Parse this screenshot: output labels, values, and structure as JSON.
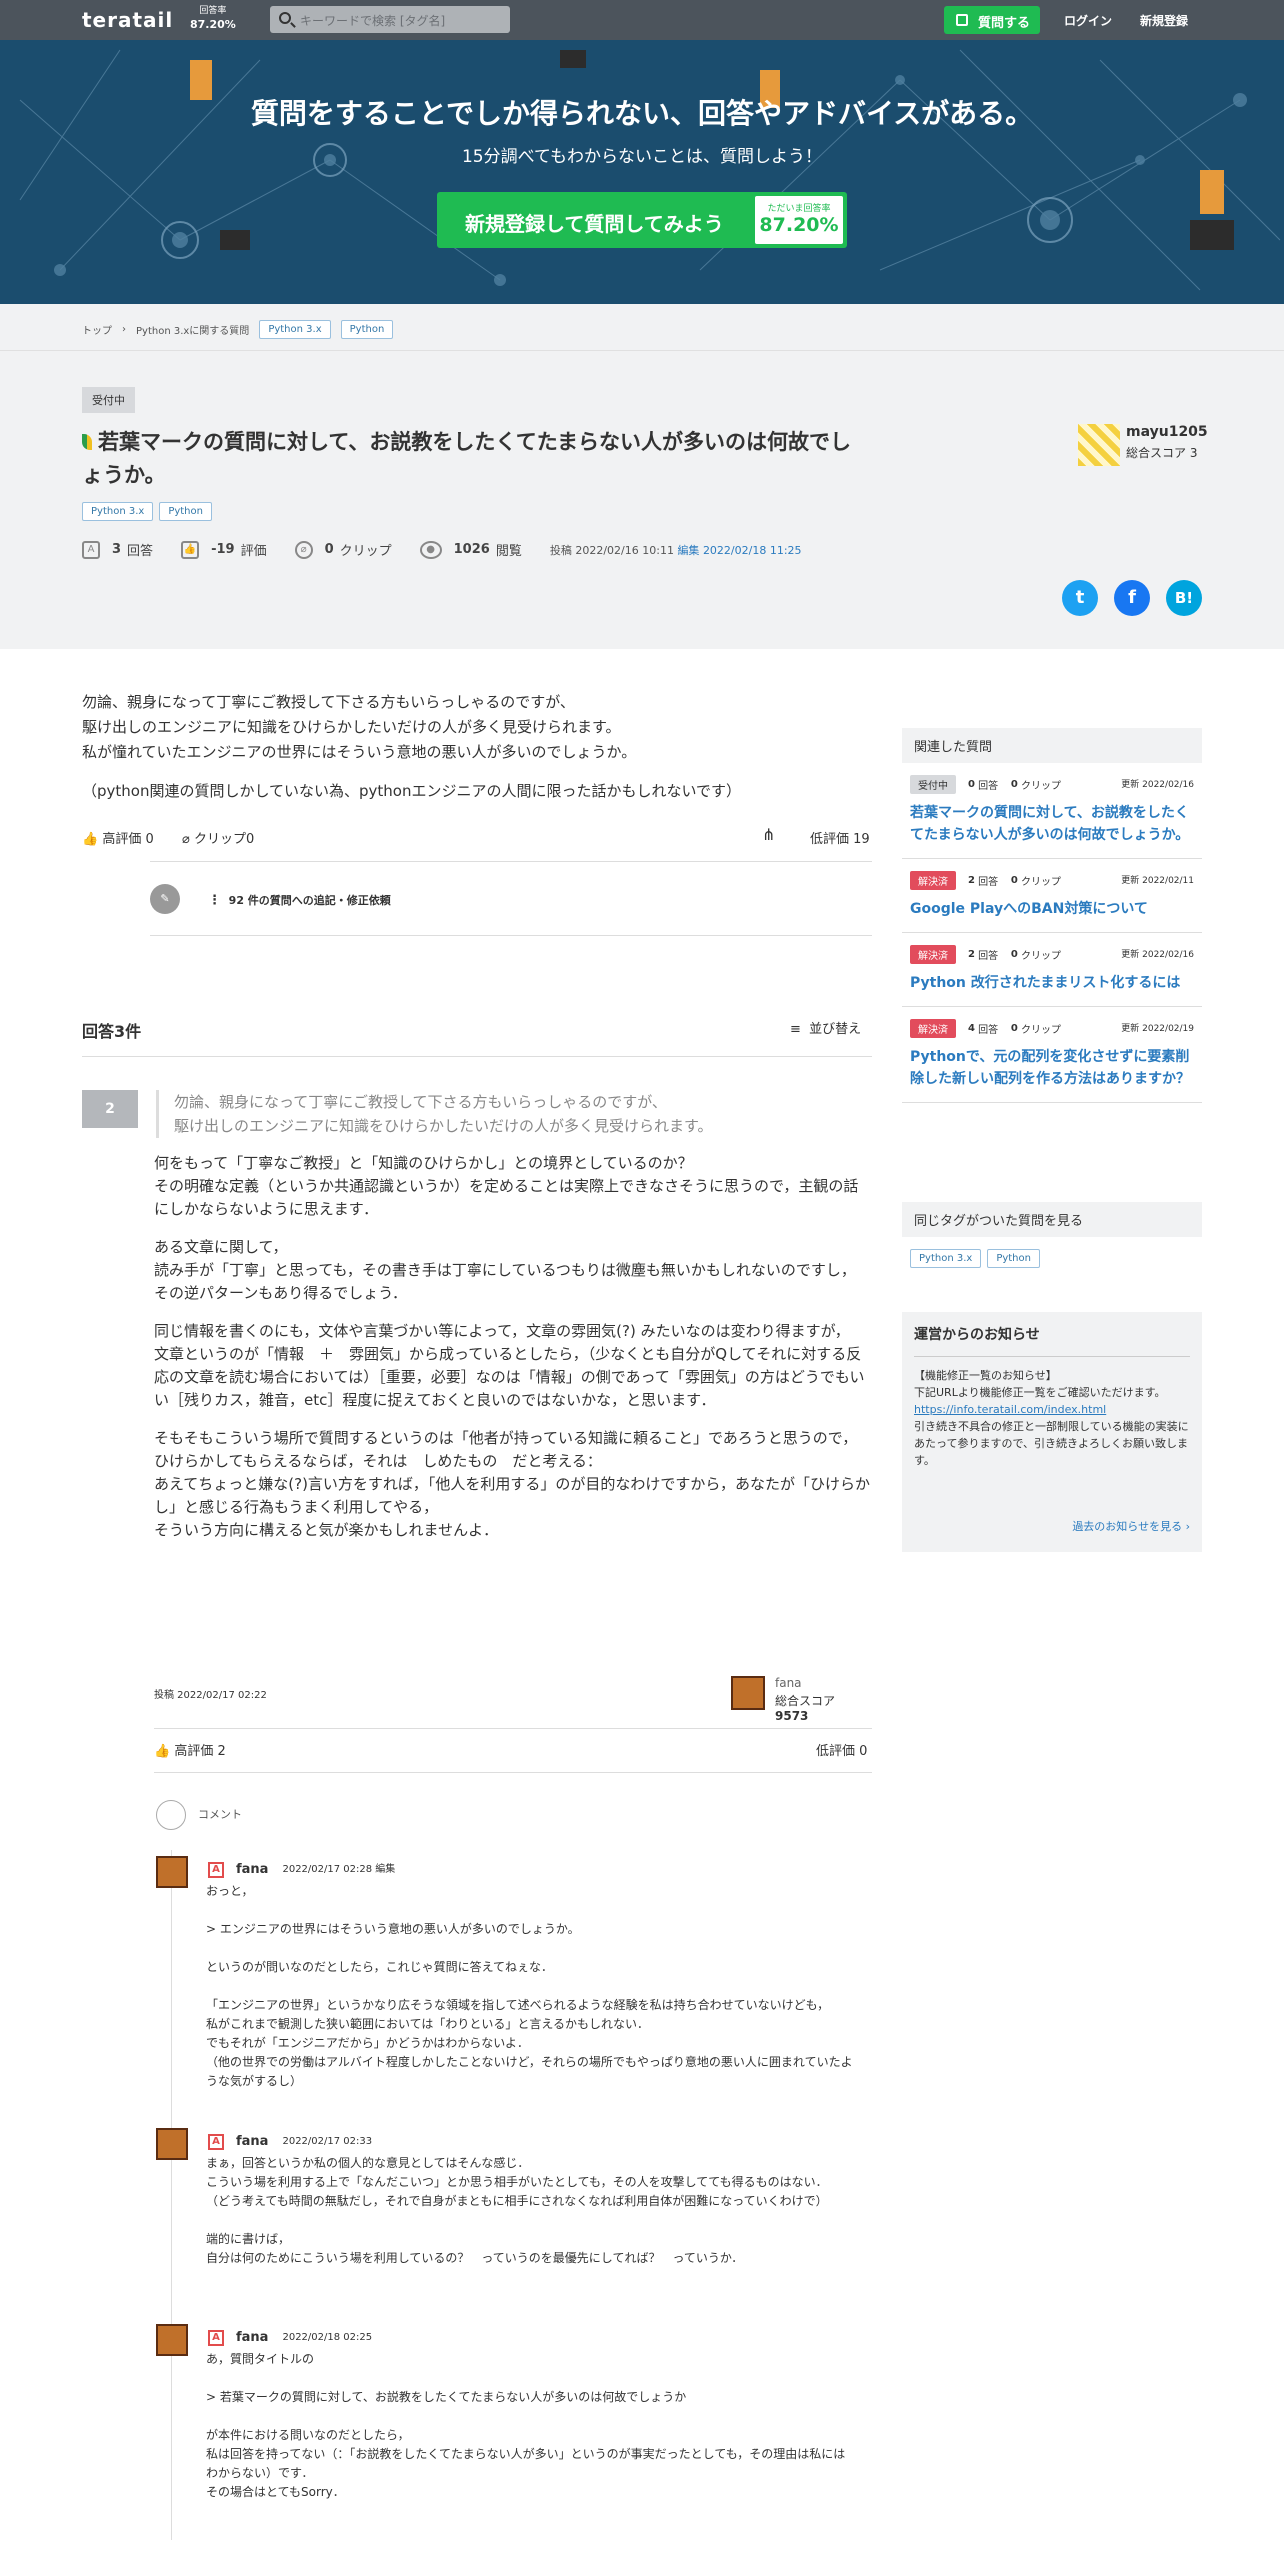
{
  "header": {
    "logo": "teratail",
    "rate_label": "回答率",
    "rate_value": "87.20%",
    "search_placeholder": "キーワードで検索 [タグ名]",
    "ask_label": "質問する",
    "login": "ログイン",
    "signup": "新規登録"
  },
  "hero": {
    "title": "質問をすることでしか得られない、回答やアドバイスがある。",
    "subtitle": "15分調べてもわからないことは、質問しよう！",
    "cta": "新規登録して質問してみよう",
    "rate_label": "ただいま回答率",
    "rate_value": "87.20%"
  },
  "breadcrumb": {
    "top": "トップ",
    "sep": "›",
    "cat": "Python 3.xに関する質問",
    "tags": [
      "Python 3.x",
      "Python"
    ]
  },
  "question": {
    "status": "受付中",
    "title": "若葉マークの質問に対して、お説教をしたくてたまらない人が多いのは何故でしょうか。",
    "tags": [
      "Python 3.x",
      "Python"
    ],
    "answers_n": "3",
    "answers_l": "回答",
    "score_n": "-19",
    "score_l": "評価",
    "clip_n": "0",
    "clip_l": "クリップ",
    "views_n": "1026",
    "views_l": "閲覧",
    "posted": "投稿 2022/02/16 10:11",
    "edit_label": "編集",
    "edited": "2022/02/18 11:25",
    "user": "mayu1205",
    "user_score": "総合スコア 3",
    "body": [
      "勿論、親身になって丁寧にご教授して下さる方もいらっしゃるのですが、",
      "駆け出しのエンジニアに知識をひけらかしたいだけの人が多く見受けられます。",
      "私が憧れていたエンジニアの世界にはそういう意地の悪い人が多いのでしょうか。",
      "",
      "（python関連の質問しかしていない為、pythonエンジニアの人間に限った話かもしれないです）"
    ],
    "good": "高評価 0",
    "clip": "クリップ0",
    "bad": "低評価 19",
    "edit_req": "92 件の質問への追記・修正依頼"
  },
  "social": {
    "twitter": "t",
    "facebook": "f",
    "hatena": "B!"
  },
  "answers": {
    "heading": "回答3件",
    "sort": "並び替え"
  },
  "answer": {
    "votes": "2",
    "quote": [
      "勿論、親身になって丁寧にご教授して下さる方もいらっしゃるのですが、",
      "駆け出しのエンジニアに知識をひけらかしたいだけの人が多く見受けられます。"
    ],
    "paras": [
      "何をもって「丁寧なご教授」と「知識のひけらかし」との境界としているのか？\nその明確な定義（というか共通認識というか）を定めることは実際上できなさそうに思うので，主観の話にしかならないように思えます．",
      "ある文章に関して，\n読み手が「丁寧」と思っても，その書き手は丁寧にしているつもりは微塵も無いかもしれないのですし，\nその逆パターンもあり得るでしょう．",
      "同じ情報を書くのにも，文体や言葉づかい等によって，文章の雰囲気(?) みたいなのは変わり得ますが，\n文章というのが「情報　＋　雰囲気」から成っているとしたら，（少なくとも自分がQしてそれに対する反応の文章を読む場合においては）［重要，必要］なのは「情報」の側であって「雰囲気」の方はどうでもいい［残りカス，雑音，etc］程度に捉えておくと良いのではないかな，と思います．",
      "そもそもこういう場所で質問するというのは「他者が持っている知識に頼ること」であろうと思うので，\nひけらかしてもらえるならば，それは　しめたもの　だと考える：\nあえてちょっと嫌な(?)言い方をすれば，「他人を利用する」のが目的なわけですから，あなたが「ひけらかし」と感じる行為もうまく利用してやる，\nそういう方向に構えると気が楽かもしれませんよ．"
    ],
    "posted": "投稿 2022/02/17 02:22",
    "user": "fana",
    "score_label": "総合スコア",
    "score": "9573",
    "good": "高評価 2",
    "bad": "低評価 0"
  },
  "comments": {
    "label": "コメント",
    "items": [
      {
        "user": "fana",
        "date": "2022/02/17 02:28",
        "edit": "編集",
        "text": "おっと，\n\n> エンジニアの世界にはそういう意地の悪い人が多いのでしょうか。\n\nというのが問いなのだとしたら，これじゃ質問に答えてねぇな．\n\n「エンジニアの世界」というかなり広そうな領域を指して述べられるような経験を私は持ち合わせていないけども，\n私がこれまで観測した狭い範囲においては「わりといる」と言えるかもしれない．\nでもそれが「エンジニアだから」かどうかはわからないよ．\n（他の世界での労働はアルバイト程度しかしたことないけど，それらの場所でもやっぱり意地の悪い人に囲まれていたような気がするし）"
      },
      {
        "user": "fana",
        "date": "2022/02/17 02:33",
        "edit": "",
        "text": "まぁ，回答というか私の個人的な意見としてはそんな感じ．\nこういう場を利用する上で「なんだこいつ」とか思う相手がいたとしても，その人を攻撃してても得るものはない．\n（どう考えても時間の無駄だし，それで自身がまともに相手にされなくなれば利用自体が困難になっていくわけで）\n\n端的に書けば，\n自分は何のためにこういう場を利用しているの？　っていうのを最優先にしてれば？　っていうか．"
      },
      {
        "user": "fana",
        "date": "2022/02/18 02:25",
        "edit": "",
        "text": "あ，質問タイトルの\n\n> 若葉マークの質問に対して、お説教をしたくてたまらない人が多いのは何故でしょうか\n\nが本件における問いなのだとしたら，\n私は回答を持ってない（：「お説教をしたくてたまらない人が多い」というのが事実だったとしても，その理由は私にはわからない）です．\nその場合はとてもSorry．"
      }
    ]
  },
  "sidebar": {
    "related_h": "関連した質問",
    "related": [
      {
        "status": "受付中",
        "status_color": "#d7d9dc",
        "status_text": "#333333",
        "ans": "0",
        "ans_l": "回答",
        "clip": "0",
        "clip_l": "クリップ",
        "upd": "更新 2022/02/16",
        "title": "若葉マークの質問に対して、お説教をしたくてたまらない人が多いのは何故でしょうか。"
      },
      {
        "status": "解決済",
        "status_color": "#e24c5c",
        "status_text": "#ffffff",
        "ans": "2",
        "ans_l": "回答",
        "clip": "0",
        "clip_l": "クリップ",
        "upd": "更新 2022/02/11",
        "title": "Google PlayへのBAN対策について"
      },
      {
        "status": "解決済",
        "status_color": "#e24c5c",
        "status_text": "#ffffff",
        "ans": "2",
        "ans_l": "回答",
        "clip": "0",
        "clip_l": "クリップ",
        "upd": "更新 2022/02/16",
        "title": "Python 改行されたままリスト化するには"
      },
      {
        "status": "解決済",
        "status_color": "#e24c5c",
        "status_text": "#ffffff",
        "ans": "4",
        "ans_l": "回答",
        "clip": "0",
        "clip_l": "クリップ",
        "upd": "更新 2022/02/19",
        "title": "Pythonで、元の配列を変化させずに要素削除した新しい配列を作る方法はありますか？"
      }
    ],
    "sametag_h": "同じタグがついた質問を見る",
    "tags": [
      "Python 3.x",
      "Python"
    ],
    "notice_h": "運営からのお知らせ",
    "notice_1": "【機能修正一覧のお知らせ】",
    "notice_2": "下記URLより機能修正一覧をご確認いただけます。",
    "notice_url": "https://info.teratail.com/index.html",
    "notice_3": "引き続き不具合の修正と一部制限している機能の実装にあたって参りますので、引き続きよろしくお願い致します。",
    "notice_more": "過去のお知らせを見る ›"
  },
  "colors": {
    "accent": "#1fbb52",
    "link": "#2b7bbf",
    "header": "#4c545c",
    "hero": "#1b4d6e"
  }
}
